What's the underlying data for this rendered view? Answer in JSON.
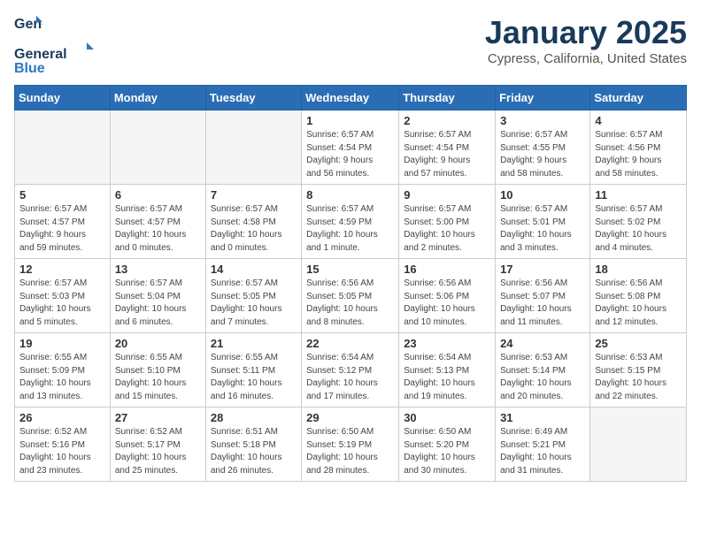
{
  "header": {
    "logo_general": "General",
    "logo_blue": "Blue",
    "month": "January 2025",
    "location": "Cypress, California, United States"
  },
  "weekdays": [
    "Sunday",
    "Monday",
    "Tuesday",
    "Wednesday",
    "Thursday",
    "Friday",
    "Saturday"
  ],
  "weeks": [
    [
      {
        "day": "",
        "info": ""
      },
      {
        "day": "",
        "info": ""
      },
      {
        "day": "",
        "info": ""
      },
      {
        "day": "1",
        "info": "Sunrise: 6:57 AM\nSunset: 4:54 PM\nDaylight: 9 hours\nand 56 minutes."
      },
      {
        "day": "2",
        "info": "Sunrise: 6:57 AM\nSunset: 4:54 PM\nDaylight: 9 hours\nand 57 minutes."
      },
      {
        "day": "3",
        "info": "Sunrise: 6:57 AM\nSunset: 4:55 PM\nDaylight: 9 hours\nand 58 minutes."
      },
      {
        "day": "4",
        "info": "Sunrise: 6:57 AM\nSunset: 4:56 PM\nDaylight: 9 hours\nand 58 minutes."
      }
    ],
    [
      {
        "day": "5",
        "info": "Sunrise: 6:57 AM\nSunset: 4:57 PM\nDaylight: 9 hours\nand 59 minutes."
      },
      {
        "day": "6",
        "info": "Sunrise: 6:57 AM\nSunset: 4:57 PM\nDaylight: 10 hours\nand 0 minutes."
      },
      {
        "day": "7",
        "info": "Sunrise: 6:57 AM\nSunset: 4:58 PM\nDaylight: 10 hours\nand 0 minutes."
      },
      {
        "day": "8",
        "info": "Sunrise: 6:57 AM\nSunset: 4:59 PM\nDaylight: 10 hours\nand 1 minute."
      },
      {
        "day": "9",
        "info": "Sunrise: 6:57 AM\nSunset: 5:00 PM\nDaylight: 10 hours\nand 2 minutes."
      },
      {
        "day": "10",
        "info": "Sunrise: 6:57 AM\nSunset: 5:01 PM\nDaylight: 10 hours\nand 3 minutes."
      },
      {
        "day": "11",
        "info": "Sunrise: 6:57 AM\nSunset: 5:02 PM\nDaylight: 10 hours\nand 4 minutes."
      }
    ],
    [
      {
        "day": "12",
        "info": "Sunrise: 6:57 AM\nSunset: 5:03 PM\nDaylight: 10 hours\nand 5 minutes."
      },
      {
        "day": "13",
        "info": "Sunrise: 6:57 AM\nSunset: 5:04 PM\nDaylight: 10 hours\nand 6 minutes."
      },
      {
        "day": "14",
        "info": "Sunrise: 6:57 AM\nSunset: 5:05 PM\nDaylight: 10 hours\nand 7 minutes."
      },
      {
        "day": "15",
        "info": "Sunrise: 6:56 AM\nSunset: 5:05 PM\nDaylight: 10 hours\nand 8 minutes."
      },
      {
        "day": "16",
        "info": "Sunrise: 6:56 AM\nSunset: 5:06 PM\nDaylight: 10 hours\nand 10 minutes."
      },
      {
        "day": "17",
        "info": "Sunrise: 6:56 AM\nSunset: 5:07 PM\nDaylight: 10 hours\nand 11 minutes."
      },
      {
        "day": "18",
        "info": "Sunrise: 6:56 AM\nSunset: 5:08 PM\nDaylight: 10 hours\nand 12 minutes."
      }
    ],
    [
      {
        "day": "19",
        "info": "Sunrise: 6:55 AM\nSunset: 5:09 PM\nDaylight: 10 hours\nand 13 minutes."
      },
      {
        "day": "20",
        "info": "Sunrise: 6:55 AM\nSunset: 5:10 PM\nDaylight: 10 hours\nand 15 minutes."
      },
      {
        "day": "21",
        "info": "Sunrise: 6:55 AM\nSunset: 5:11 PM\nDaylight: 10 hours\nand 16 minutes."
      },
      {
        "day": "22",
        "info": "Sunrise: 6:54 AM\nSunset: 5:12 PM\nDaylight: 10 hours\nand 17 minutes."
      },
      {
        "day": "23",
        "info": "Sunrise: 6:54 AM\nSunset: 5:13 PM\nDaylight: 10 hours\nand 19 minutes."
      },
      {
        "day": "24",
        "info": "Sunrise: 6:53 AM\nSunset: 5:14 PM\nDaylight: 10 hours\nand 20 minutes."
      },
      {
        "day": "25",
        "info": "Sunrise: 6:53 AM\nSunset: 5:15 PM\nDaylight: 10 hours\nand 22 minutes."
      }
    ],
    [
      {
        "day": "26",
        "info": "Sunrise: 6:52 AM\nSunset: 5:16 PM\nDaylight: 10 hours\nand 23 minutes."
      },
      {
        "day": "27",
        "info": "Sunrise: 6:52 AM\nSunset: 5:17 PM\nDaylight: 10 hours\nand 25 minutes."
      },
      {
        "day": "28",
        "info": "Sunrise: 6:51 AM\nSunset: 5:18 PM\nDaylight: 10 hours\nand 26 minutes."
      },
      {
        "day": "29",
        "info": "Sunrise: 6:50 AM\nSunset: 5:19 PM\nDaylight: 10 hours\nand 28 minutes."
      },
      {
        "day": "30",
        "info": "Sunrise: 6:50 AM\nSunset: 5:20 PM\nDaylight: 10 hours\nand 30 minutes."
      },
      {
        "day": "31",
        "info": "Sunrise: 6:49 AM\nSunset: 5:21 PM\nDaylight: 10 hours\nand 31 minutes."
      },
      {
        "day": "",
        "info": ""
      }
    ]
  ]
}
